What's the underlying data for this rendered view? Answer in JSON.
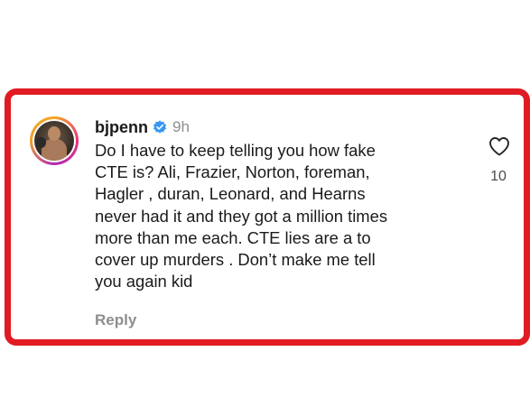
{
  "comment": {
    "username": "bjpenn",
    "time": "9h",
    "lines": [
      "Do I have to keep telling you how fake",
      "CTE is? Ali, Frazier, Norton, foreman,",
      "Hagler , duran, Leonard, and Hearns",
      "never had it and they got a million times",
      "more than me each. CTE lies are a to",
      "cover up murders . Don’t make me tell",
      "you again kid"
    ],
    "reply_label": "Reply",
    "like_count": "10"
  },
  "icons": {
    "verified": "verified-badge-icon",
    "like": "heart-icon"
  },
  "colors": {
    "frame_border": "#e01b22",
    "verified_blue": "#3897f0",
    "muted_text": "#8e8e8e"
  }
}
